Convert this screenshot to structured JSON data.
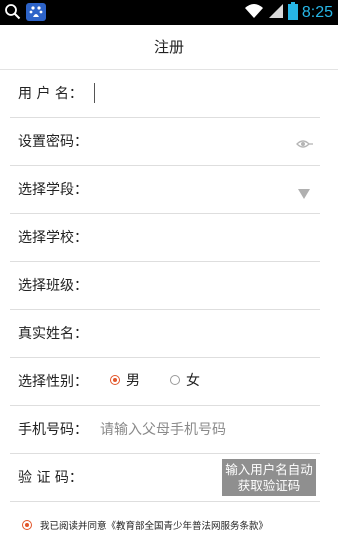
{
  "status_bar": {
    "time": "8:25",
    "icons": [
      "search-icon",
      "app-icon",
      "wifi-icon",
      "signal-icon",
      "battery-icon"
    ],
    "time_color": "#27b6e6"
  },
  "header": {
    "title": "注册"
  },
  "form": {
    "username": {
      "label": "用 户 名：",
      "value": ""
    },
    "password": {
      "label": "设置密码：",
      "value": "",
      "toggle_icon": "eye-icon"
    },
    "stage": {
      "label": "选择学段：",
      "value": "",
      "dropdown_icon": "triangle-down-icon"
    },
    "school": {
      "label": "选择学校：",
      "value": ""
    },
    "class": {
      "label": "选择班级：",
      "value": ""
    },
    "realname": {
      "label": "真实姓名：",
      "value": ""
    },
    "gender": {
      "label": "选择性别：",
      "options": [
        {
          "label": "男",
          "selected": true
        },
        {
          "label": "女",
          "selected": false
        }
      ]
    },
    "phone": {
      "label": "手机号码：",
      "placeholder": "请输入父母手机号码"
    },
    "code": {
      "label": "验 证 码：",
      "button_line1": "输入用户名自动",
      "button_line2": "获取验证码"
    }
  },
  "agreement": {
    "checked": true,
    "text": "我已阅读并同意《教育部全国青少年普法网服务条款》"
  },
  "colors": {
    "accent": "#e2562a",
    "button_bg": "#8f8f8f",
    "divider": "#dedede"
  }
}
